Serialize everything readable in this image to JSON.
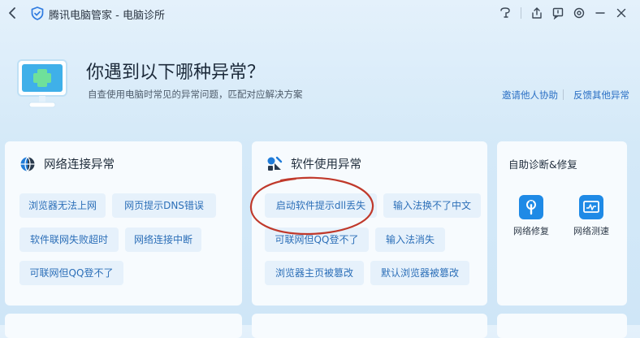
{
  "titlebar": {
    "title": "腾讯电脑管家 - 电脑诊所",
    "icons": [
      "feedback-icon",
      "share-icon",
      "message-icon",
      "settings-icon",
      "minimize-icon",
      "close-icon"
    ]
  },
  "hero": {
    "title": "你遇到以下哪种异常？",
    "subtitle": "自查使用电脑时常见的异常问题，匹配对应解决方案",
    "link_invite": "邀请他人协助",
    "link_other": "反馈其他异常"
  },
  "network": {
    "title": "网络连接异常",
    "items": [
      "浏览器无法上网",
      "网页提示DNS错误",
      "软件联网失败超时",
      "网络连接中断",
      "可联网但QQ登不了"
    ]
  },
  "software": {
    "title": "软件使用异常",
    "items": [
      "启动软件提示dll丢失",
      "输入法换不了中文",
      "可联网但QQ登不了",
      "输入法消失",
      "浏览器主页被篡改",
      "默认浏览器被篡改"
    ]
  },
  "selfhelp": {
    "title": "自助诊断&修复",
    "tools": [
      {
        "label": "网络修复",
        "icon": "network-repair-icon"
      },
      {
        "label": "网络测速",
        "icon": "speed-test-icon"
      }
    ]
  },
  "colors": {
    "accent": "#2c6fb8",
    "chip_bg": "#e6f1fb",
    "highlight": "#c0392b"
  }
}
